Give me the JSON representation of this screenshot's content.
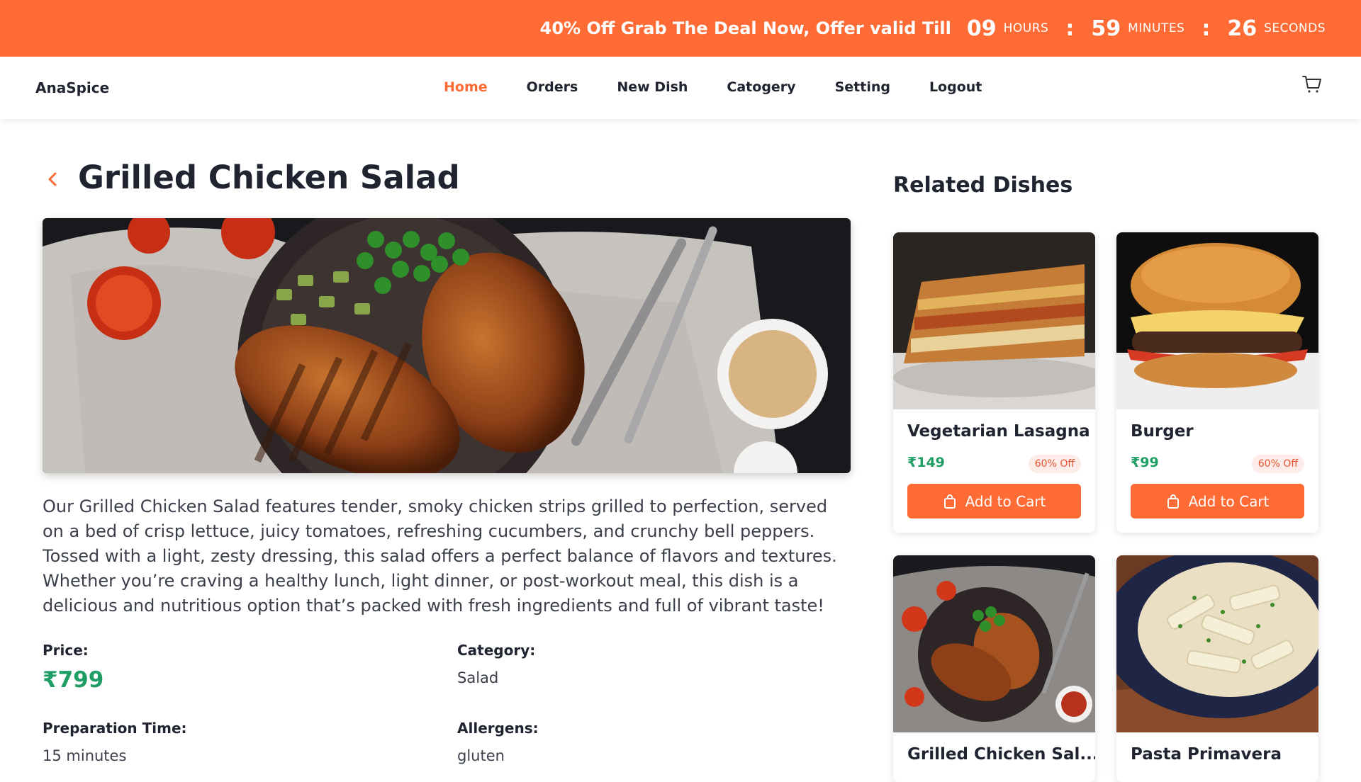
{
  "promo": {
    "text": "40% Off Grab The Deal Now, Offer valid Till",
    "hours": "09",
    "hours_label": "HOURS",
    "minutes": "59",
    "minutes_label": "MINUTES",
    "seconds": "26",
    "seconds_label": "SECONDS",
    "separator": ":"
  },
  "nav": {
    "brand": "AnaSpice",
    "links": [
      "Home",
      "Orders",
      "New Dish",
      "Catogery",
      "Setting",
      "Logout"
    ],
    "active": "Home",
    "cart_icon": "cart-icon"
  },
  "dish": {
    "title": "Grilled Chicken Salad",
    "description": "Our Grilled Chicken Salad features tender, smoky chicken strips grilled to perfection, served on a bed of crisp lettuce, juicy tomatoes, refreshing cucumbers, and crunchy bell peppers. Tossed with a light, zesty dressing, this salad offers a perfect balance of flavors and textures. Whether you’re craving a healthy lunch, light dinner, or post-workout meal, this dish is a delicious and nutritious option that’s packed with fresh ingredients and full of vibrant taste!",
    "price_label": "Price:",
    "price": "₹799",
    "category_label": "Category:",
    "category": "Salad",
    "prep_label": "Preparation Time:",
    "prep": "15 minutes",
    "allergens_label": "Allergens:",
    "allergens": "gluten"
  },
  "related": {
    "title": "Related Dishes",
    "items": [
      {
        "name": "Vegetarian Lasagna",
        "price": "₹149",
        "discount": "60% Off",
        "button": "Add to Cart"
      },
      {
        "name": "Burger",
        "price": "₹99",
        "discount": "60% Off",
        "button": "Add to Cart"
      },
      {
        "name": "Grilled Chicken Sal...",
        "price": "",
        "discount": "",
        "button": ""
      },
      {
        "name": "Pasta Primavera",
        "price": "",
        "discount": "",
        "button": ""
      }
    ]
  },
  "colors": {
    "accent": "#ff6b35",
    "price_green": "#1e9e64",
    "badge_bg": "#fdecea"
  }
}
